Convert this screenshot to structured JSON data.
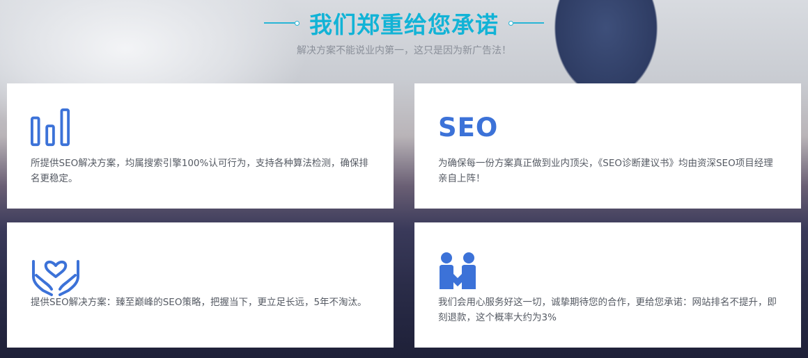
{
  "header": {
    "title": "我们郑重给您承诺",
    "subtitle": "解决方案不能说业内第一，这只是因为新广告法！"
  },
  "cards": [
    {
      "icon": "bar-chart-icon",
      "desc": "所提供SEO解决方案，均属搜索引擎100%认可行为，支持各种算法检测，确保排名更稳定。"
    },
    {
      "icon": "seo-icon",
      "icon_text": "SEO",
      "desc": "为确保每一份方案真正做到业内顶尖，《SEO诊断建议书》均由资深SEO项目经理亲自上阵！"
    },
    {
      "icon": "caring-hands-heart-icon",
      "desc": "提供SEO解决方案：臻至巅峰的SEO策略，把握当下，更立足长远，5年不淘汰。"
    },
    {
      "icon": "handshake-people-icon",
      "desc": "我们会用心服务好这一切，诚挚期待您的合作，更给您承诺：网站排名不提升，即刻退款，这个概率大约为3%"
    }
  ],
  "colors": {
    "title": "#12b3d6",
    "icon": "#3c72d8",
    "text": "#555a63",
    "subtitle": "#8a8f99"
  }
}
